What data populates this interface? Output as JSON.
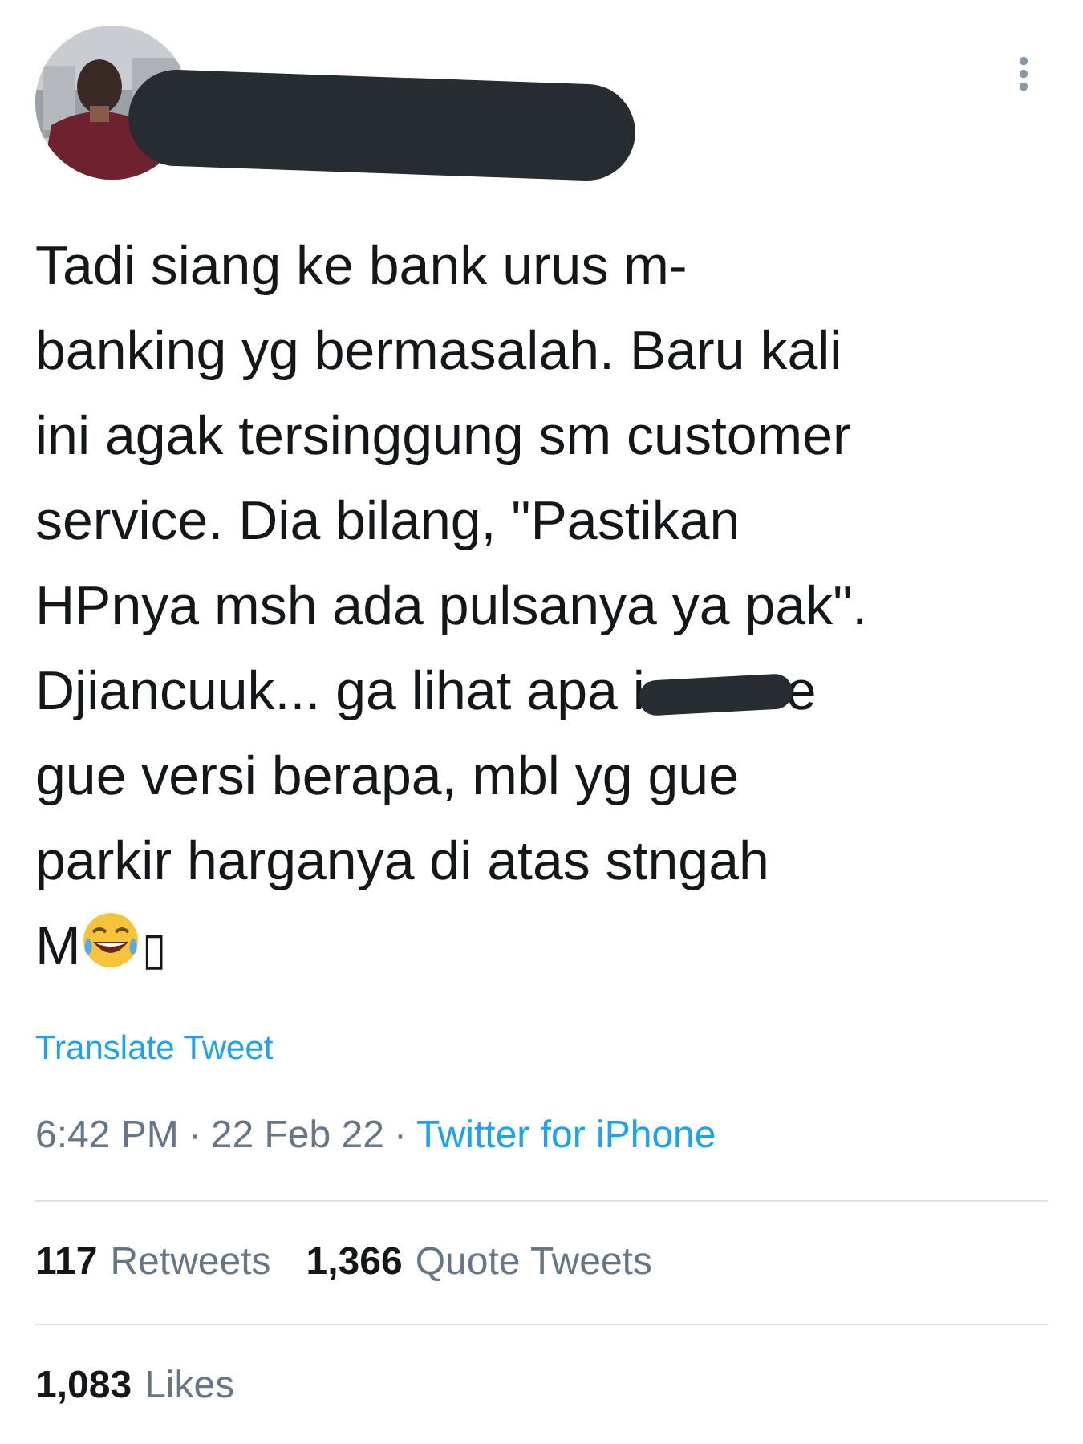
{
  "body": {
    "lines": [
      [
        {
          "kind": "text",
          "text": "Tadi siang ke bank urus m-"
        }
      ],
      [
        {
          "kind": "text",
          "text": "banking yg bermasalah. Baru kali"
        }
      ],
      [
        {
          "kind": "text",
          "text": "ini agak tersinggung sm customer"
        }
      ],
      [
        {
          "kind": "text",
          "text": "service. Dia bilang, \"Pastikan"
        }
      ],
      [
        {
          "kind": "text",
          "text": "HPnya msh ada pulsanya ya pak\"."
        }
      ],
      [
        {
          "kind": "text",
          "text": "Djiancuuk... ga lihat apa i"
        },
        {
          "kind": "redaction"
        },
        {
          "kind": "text",
          "text": "e"
        }
      ],
      [
        {
          "kind": "text",
          "text": "gue versi berapa, mbl yg gue"
        }
      ],
      [
        {
          "kind": "text",
          "text": "parkir harganya di atas stngah"
        }
      ],
      [
        {
          "kind": "text",
          "text": "M"
        },
        {
          "kind": "emoji"
        },
        {
          "kind": "glyph",
          "text": "▯"
        }
      ]
    ]
  },
  "translate": "Translate Tweet",
  "meta": {
    "time": "6:42 PM",
    "separator": "·",
    "date": "22 Feb 22",
    "source": "Twitter for iPhone"
  },
  "stats": [
    {
      "count": "117",
      "label": "Retweets"
    },
    {
      "count": "1,366",
      "label": "Quote Tweets"
    }
  ],
  "likes": {
    "count": "1,083",
    "label": "Likes"
  }
}
